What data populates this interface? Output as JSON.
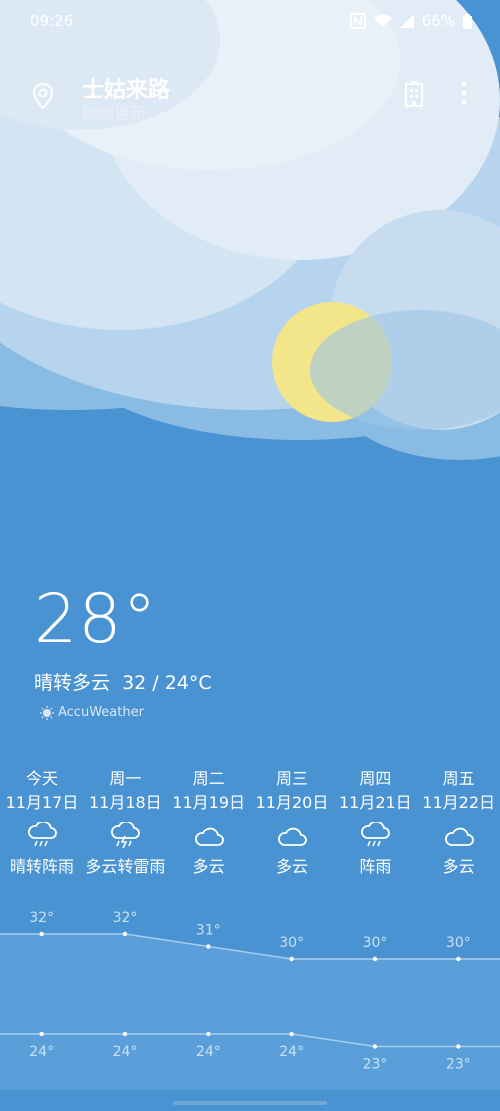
{
  "status": {
    "time": "09:26",
    "battery": "66%"
  },
  "location": {
    "city": "士姑来路",
    "sub": "刚刚更新"
  },
  "current": {
    "temp": "28°",
    "condition": "晴转多云",
    "range": "32 / 24°C"
  },
  "brand": "AccuWeather",
  "forecast": [
    {
      "weekday": "今天",
      "date": "11月17日",
      "icon": "rain-icon",
      "condition": "晴转阵雨",
      "high": 32,
      "low": 24,
      "high_label": "32°",
      "low_label": "24°"
    },
    {
      "weekday": "周一",
      "date": "11月18日",
      "icon": "thunderstorm-icon",
      "condition": "多云转雷雨",
      "high": 32,
      "low": 24,
      "high_label": "32°",
      "low_label": "24°"
    },
    {
      "weekday": "周二",
      "date": "11月19日",
      "icon": "cloud-icon",
      "condition": "多云",
      "high": 31,
      "low": 24,
      "high_label": "31°",
      "low_label": "24°"
    },
    {
      "weekday": "周三",
      "date": "11月20日",
      "icon": "cloud-icon",
      "condition": "多云",
      "high": 30,
      "low": 24,
      "high_label": "30°",
      "low_label": "24°"
    },
    {
      "weekday": "周四",
      "date": "11月21日",
      "icon": "rain-icon",
      "condition": "阵雨",
      "high": 30,
      "low": 23,
      "high_label": "30°",
      "low_label": "23°"
    },
    {
      "weekday": "周五",
      "date": "11月22日",
      "icon": "cloud-icon",
      "condition": "多云",
      "high": 30,
      "low": 23,
      "high_label": "30°",
      "low_label": "23°"
    }
  ],
  "colors": {
    "sky_blue": "#4a93d2",
    "sun": "#f2e58a",
    "cloud_white": "#ffffff"
  }
}
